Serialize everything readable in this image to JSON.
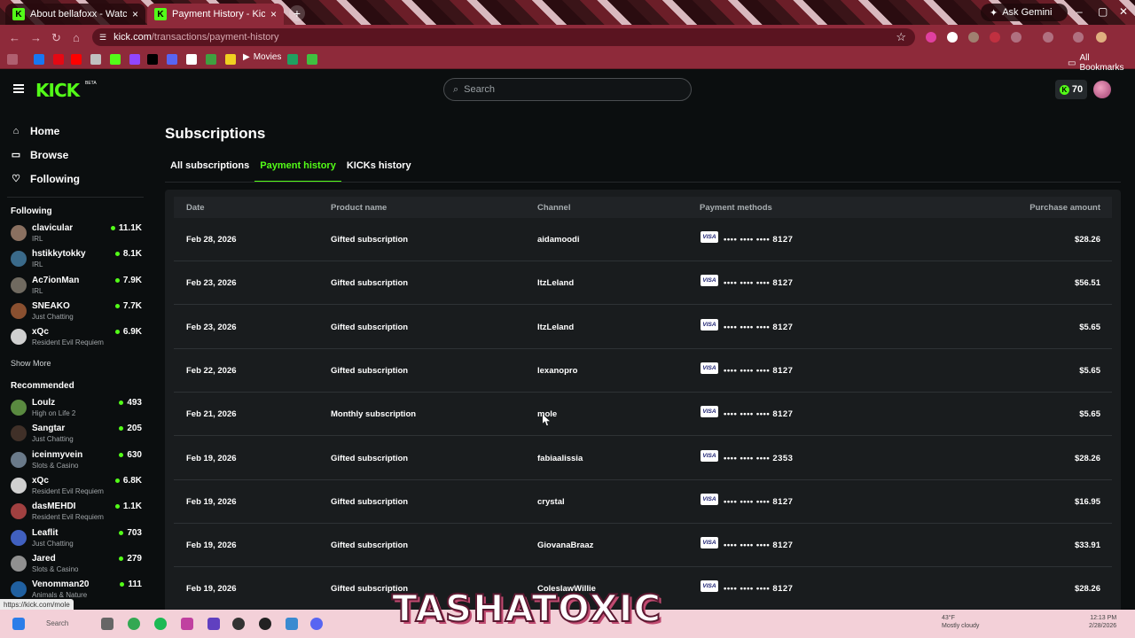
{
  "browser": {
    "tabs": [
      {
        "title": "About bellafoxx - Watch Live o",
        "favicon": "K"
      },
      {
        "title": "Payment History - Kick Streami",
        "favicon": "K"
      }
    ],
    "ask_gemini": "Ask Gemini",
    "url_host": "kick.com",
    "url_path": "/transactions/payment-history",
    "bookmarks": {
      "movies": "Movies",
      "all": "All Bookmarks"
    },
    "status_url": "https://kick.com/mole"
  },
  "kick": {
    "logo": "KICK",
    "beta": "BETA",
    "search_placeholder": "Search",
    "kicks_count": "70",
    "nav": {
      "home": "Home",
      "browse": "Browse",
      "following": "Following"
    },
    "following_title": "Following",
    "following": [
      {
        "name": "clavicular",
        "category": "IRL",
        "viewers": "11.1K",
        "color": "#8a7060"
      },
      {
        "name": "hstikkytokky",
        "category": "IRL",
        "viewers": "8.1K",
        "color": "#3a6a8a"
      },
      {
        "name": "Ac7ionMan",
        "category": "IRL",
        "viewers": "7.9K",
        "color": "#706a60"
      },
      {
        "name": "SNEAKO",
        "category": "Just Chatting",
        "viewers": "7.7K",
        "color": "#8a5030"
      },
      {
        "name": "xQc",
        "category": "Resident Evil Requiem",
        "viewers": "6.9K",
        "color": "#d0d0d0"
      }
    ],
    "show_more": "Show More",
    "recommended_title": "Recommended",
    "recommended": [
      {
        "name": "Loulz",
        "category": "High on Life 2",
        "viewers": "493",
        "color": "#5a8a40"
      },
      {
        "name": "Sangtar",
        "category": "Just Chatting",
        "viewers": "205",
        "color": "#403028"
      },
      {
        "name": "iceinmyvein",
        "category": "Slots & Casino",
        "viewers": "630",
        "color": "#6a7a8a"
      },
      {
        "name": "xQc",
        "category": "Resident Evil Requiem",
        "viewers": "6.8K",
        "color": "#d0d0d0"
      },
      {
        "name": "dasMEHDI",
        "category": "Resident Evil Requiem",
        "viewers": "1.1K",
        "color": "#a04040"
      },
      {
        "name": "Leaflit",
        "category": "Just Chatting",
        "viewers": "703",
        "color": "#4060c0"
      },
      {
        "name": "Jared",
        "category": "Slots & Casino",
        "viewers": "279",
        "color": "#909090"
      },
      {
        "name": "Venomman20",
        "category": "Animals & Nature",
        "viewers": "111",
        "color": "#2060a0"
      }
    ]
  },
  "page": {
    "title": "Subscriptions",
    "tabs": [
      "All subscriptions",
      "Payment history",
      "KICKs history"
    ],
    "columns": [
      "Date",
      "Product name",
      "Channel",
      "Payment methods",
      "Purchase amount"
    ],
    "card_brand": "VISA",
    "rows": [
      {
        "date": "Feb 28, 2026",
        "product": "Gifted subscription",
        "channel": "aidamoodi",
        "card": "•••• •••• •••• 8127",
        "amount": "$28.26"
      },
      {
        "date": "Feb 23, 2026",
        "product": "Gifted subscription",
        "channel": "ItzLeland",
        "card": "•••• •••• •••• 8127",
        "amount": "$56.51"
      },
      {
        "date": "Feb 23, 2026",
        "product": "Gifted subscription",
        "channel": "ItzLeland",
        "card": "•••• •••• •••• 8127",
        "amount": "$5.65"
      },
      {
        "date": "Feb 22, 2026",
        "product": "Gifted subscription",
        "channel": "lexanopro",
        "card": "•••• •••• •••• 8127",
        "amount": "$5.65"
      },
      {
        "date": "Feb 21, 2026",
        "product": "Monthly subscription",
        "channel": "mole",
        "card": "•••• •••• •••• 8127",
        "amount": "$5.65"
      },
      {
        "date": "Feb 19, 2026",
        "product": "Gifted subscription",
        "channel": "fabiaalissia",
        "card": "•••• •••• •••• 2353",
        "amount": "$28.26"
      },
      {
        "date": "Feb 19, 2026",
        "product": "Gifted subscription",
        "channel": "crystal",
        "card": "•••• •••• •••• 8127",
        "amount": "$16.95"
      },
      {
        "date": "Feb 19, 2026",
        "product": "Gifted subscription",
        "channel": "GiovanaBraaz",
        "card": "•••• •••• •••• 8127",
        "amount": "$33.91"
      },
      {
        "date": "Feb 19, 2026",
        "product": "Gifted subscription",
        "channel": "ColeslawWillie",
        "card": "•••• •••• •••• 8127",
        "amount": "$28.26"
      }
    ]
  },
  "taskbar": {
    "search": "Search",
    "weather_temp": "43°F",
    "weather_desc": "Mostly cloudy",
    "time": "12:13 PM",
    "date": "2/28/2026"
  },
  "overlay": {
    "text": "TASHATOXIC"
  },
  "colors": {
    "accent": "#53fc18",
    "chrome": "#8e2a3a",
    "bg": "#0b0e0f"
  }
}
